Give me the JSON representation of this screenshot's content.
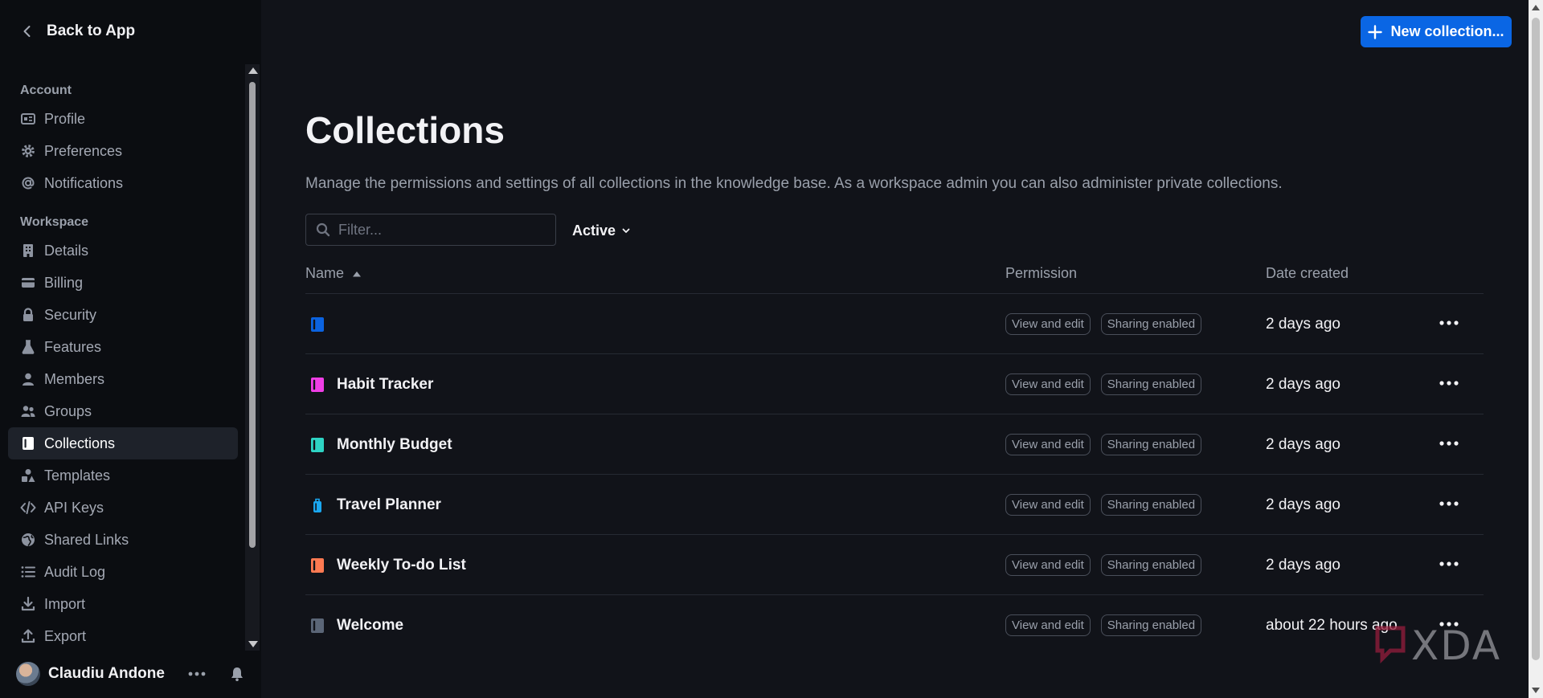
{
  "sidebar": {
    "back_label": "Back to App",
    "sections": [
      {
        "title": "Account",
        "items": [
          {
            "label": "Profile",
            "icon": "profile-card-icon"
          },
          {
            "label": "Preferences",
            "icon": "gear-icon"
          },
          {
            "label": "Notifications",
            "icon": "at-sign-icon"
          }
        ]
      },
      {
        "title": "Workspace",
        "items": [
          {
            "label": "Details",
            "icon": "building-icon"
          },
          {
            "label": "Billing",
            "icon": "credit-card-icon"
          },
          {
            "label": "Security",
            "icon": "lock-icon"
          },
          {
            "label": "Features",
            "icon": "beaker-icon"
          },
          {
            "label": "Members",
            "icon": "user-icon"
          },
          {
            "label": "Groups",
            "icon": "group-icon"
          },
          {
            "label": "Collections",
            "icon": "collection-icon",
            "active": true
          },
          {
            "label": "Templates",
            "icon": "shapes-icon"
          },
          {
            "label": "API Keys",
            "icon": "code-icon"
          },
          {
            "label": "Shared Links",
            "icon": "globe-icon"
          },
          {
            "label": "Audit Log",
            "icon": "list-icon"
          },
          {
            "label": "Import",
            "icon": "download-icon"
          },
          {
            "label": "Export",
            "icon": "upload-icon"
          }
        ]
      }
    ],
    "user": {
      "name": "Claudiu Andone"
    }
  },
  "header": {
    "new_button_label": "New collection..."
  },
  "main": {
    "title": "Collections",
    "description": "Manage the permissions and settings of all collections in the knowledge base. As a workspace admin you can also administer private collections.",
    "filter": {
      "placeholder": "Filter...",
      "value": ""
    },
    "status_filter": "Active",
    "columns": {
      "name": "Name",
      "permission": "Permission",
      "date": "Date created"
    },
    "rows": [
      {
        "name": "",
        "color": "#0b63e0",
        "permission": "View and edit",
        "sharing": "Sharing enabled",
        "date": "2 days ago"
      },
      {
        "name": "Habit Tracker",
        "color": "#f03ee6",
        "permission": "View and edit",
        "sharing": "Sharing enabled",
        "date": "2 days ago"
      },
      {
        "name": "Monthly Budget",
        "color": "#2ed4c4",
        "permission": "View and edit",
        "sharing": "Sharing enabled",
        "date": "2 days ago"
      },
      {
        "name": "Travel Planner",
        "color": "#1aa7f0",
        "permission": "View and edit",
        "sharing": "Sharing enabled",
        "date": "2 days ago",
        "icon_variant": "luggage"
      },
      {
        "name": "Weekly To-do List",
        "color": "#ff7a52",
        "permission": "View and edit",
        "sharing": "Sharing enabled",
        "date": "2 days ago"
      },
      {
        "name": "Welcome",
        "color": "#5b6677",
        "permission": "View and edit",
        "sharing": "Sharing enabled",
        "date": "about 22 hours ago"
      }
    ]
  },
  "watermark": {
    "text": "XDA"
  },
  "colors": {
    "accent": "#0a66e4",
    "background": "#111319",
    "sidebar": "#0b0d11"
  }
}
